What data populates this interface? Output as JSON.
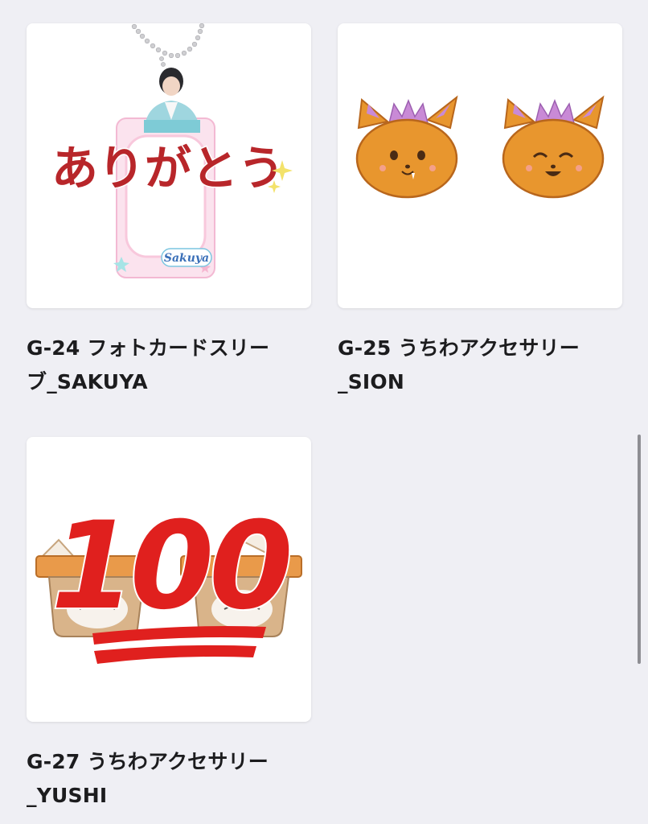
{
  "products": [
    {
      "title_line1": "G-24 フォトカードスリー",
      "title_line2": "ブ_SAKUYA",
      "image": {
        "headline": "ありがとう",
        "name_script": "Sakuya"
      }
    },
    {
      "title_line1": "G-25 うちわアクセサリー",
      "title_line2": "_SION",
      "image": {}
    },
    {
      "title_line1": "G-27 うちわアクセサリー",
      "title_line2": "_YUSHI",
      "image": {
        "number": "100"
      }
    }
  ],
  "colors": {
    "background": "#efeff4",
    "card": "#ffffff",
    "title_text": "#1c1c1e",
    "headline_red": "#b8262a",
    "fox_orange": "#e8962e",
    "number_red": "#e0201e"
  }
}
